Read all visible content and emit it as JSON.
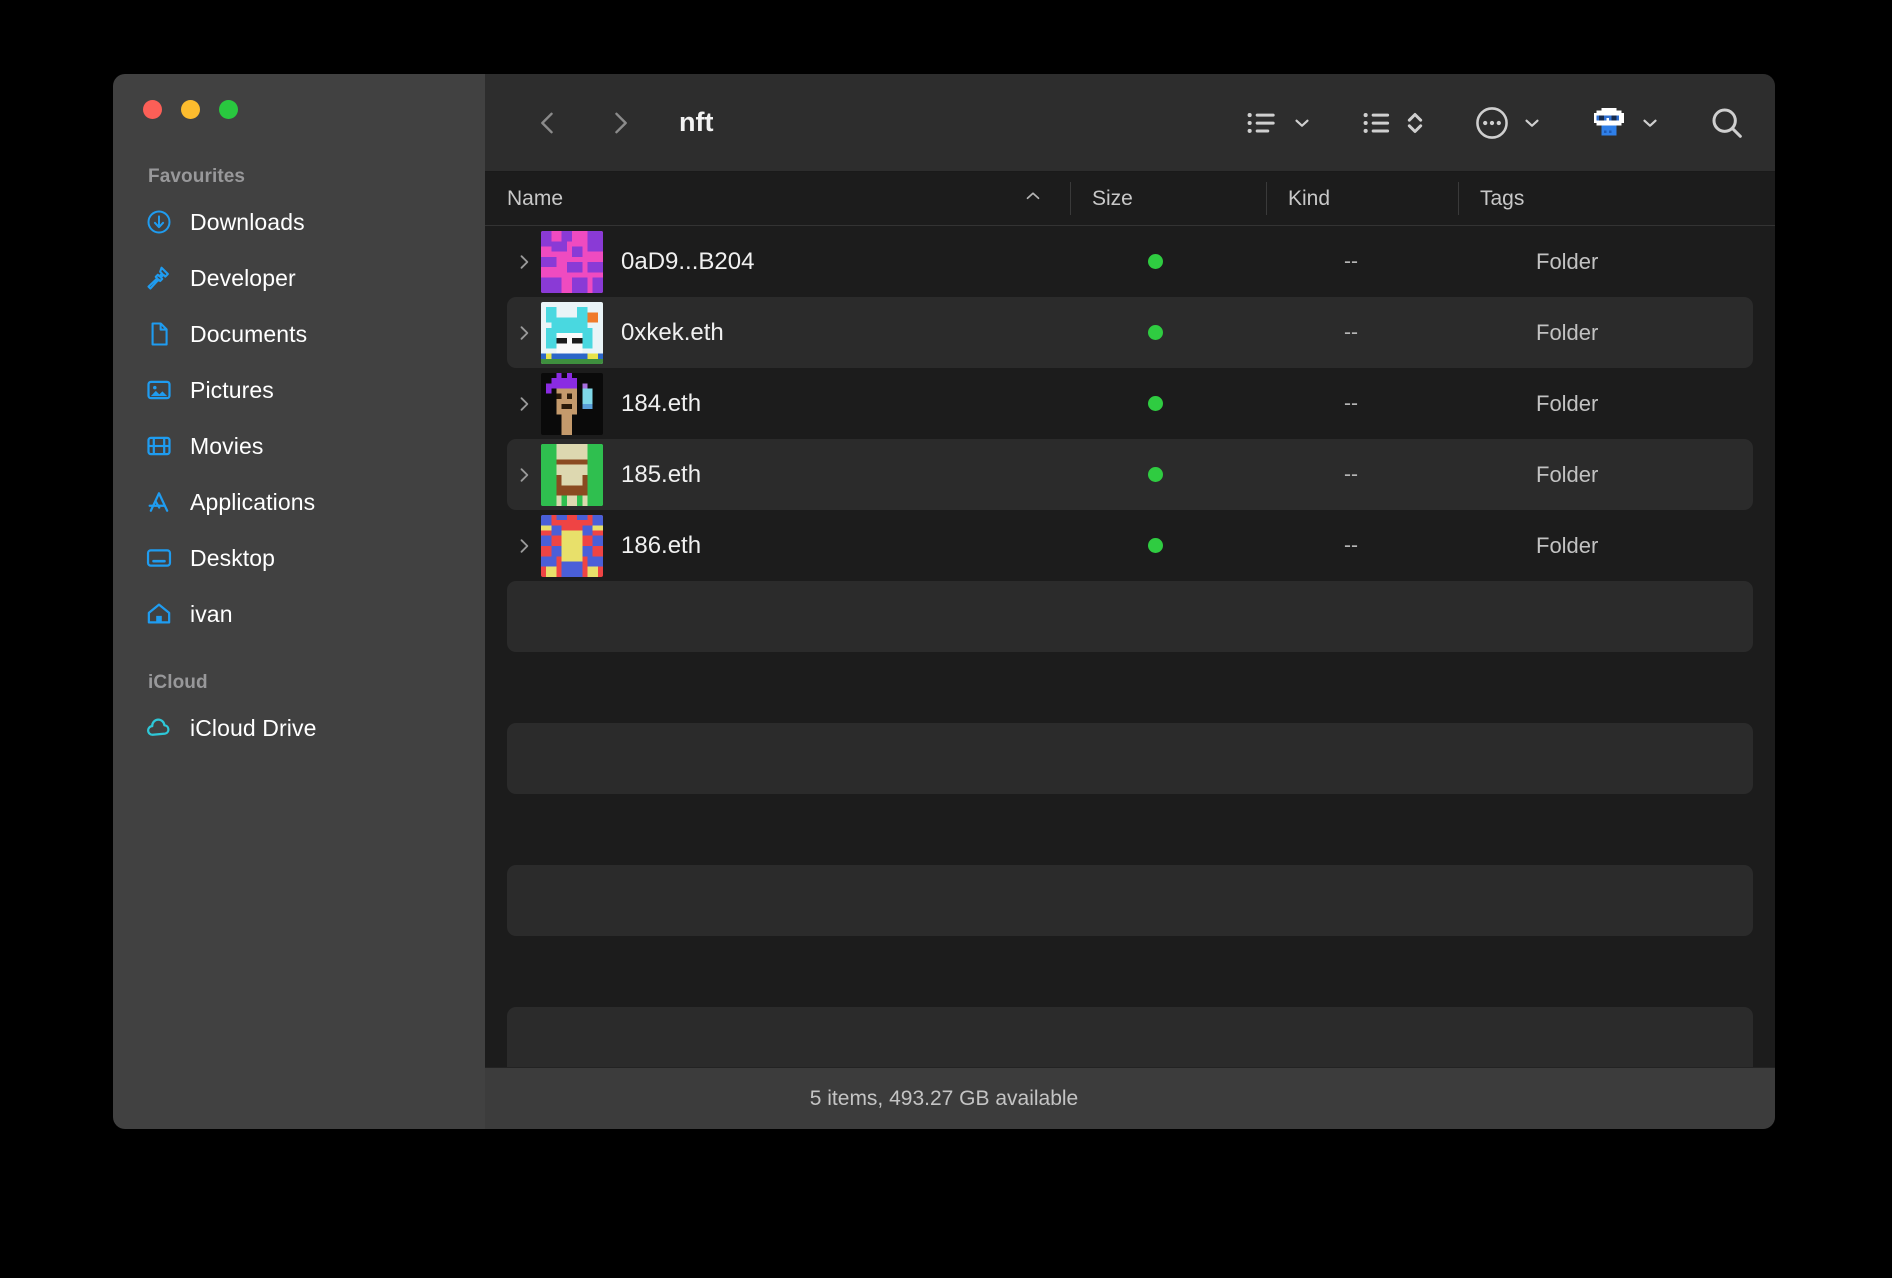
{
  "window": {
    "traffic_lights": [
      "close",
      "minimize",
      "zoom"
    ],
    "colors": {
      "desktop": "#000000",
      "sidebar": "#414141",
      "content": "#1c1c1c",
      "toolbar": "#2d2d2d",
      "status_bar": "#3c3c3c",
      "accent_blue": "#1f9cf0",
      "accent_cyan": "#2ec8d8",
      "tag_green": "#2fcc41",
      "row_alt": "#2b2b2b"
    }
  },
  "sidebar": {
    "sections": [
      {
        "title": "Favourites",
        "items": [
          {
            "label": "Downloads",
            "icon": "downloads-circle-arrow-icon"
          },
          {
            "label": "Developer",
            "icon": "hammer-icon"
          },
          {
            "label": "Documents",
            "icon": "document-page-icon"
          },
          {
            "label": "Pictures",
            "icon": "photo-icon"
          },
          {
            "label": "Movies",
            "icon": "film-strip-icon"
          },
          {
            "label": "Applications",
            "icon": "app-store-a-icon"
          },
          {
            "label": "Desktop",
            "icon": "desktop-monitor-icon"
          },
          {
            "label": "ivan",
            "icon": "home-house-icon"
          }
        ]
      },
      {
        "title": "iCloud",
        "items": [
          {
            "label": "iCloud Drive",
            "icon": "cloud-icon"
          }
        ]
      }
    ]
  },
  "toolbar": {
    "back_label": "Back",
    "forward_label": "Forward",
    "title": "nft",
    "buttons": [
      {
        "name": "view-options",
        "icon": "list-view-icon",
        "chevron": true
      },
      {
        "name": "group-sort",
        "icon": "list-sort-icon",
        "chevron": false
      },
      {
        "name": "more-actions",
        "icon": "ellipsis-circle-icon",
        "chevron": true
      },
      {
        "name": "share-avatar",
        "icon": "pixel-cloud-avatar-icon",
        "chevron": true
      },
      {
        "name": "search",
        "icon": "search-magnifier-icon",
        "chevron": false
      }
    ]
  },
  "columns": [
    {
      "key": "name",
      "label": "Name",
      "sorted": true,
      "sort_direction": "ascending"
    },
    {
      "key": "size",
      "label": "Size",
      "sorted": false,
      "sort_direction": ""
    },
    {
      "key": "kind",
      "label": "Kind",
      "sorted": false,
      "sort_direction": ""
    },
    {
      "key": "tags",
      "label": "Tags",
      "sorted": false,
      "sort_direction": ""
    }
  ],
  "files": [
    {
      "name": "0aD9...B204",
      "size": "--",
      "kind": "Folder",
      "tag_color": "#2fcc41",
      "expandable": true,
      "thumbnail": "pink-purple-pixel-art"
    },
    {
      "name": "0xkek.eth",
      "size": "--",
      "kind": "Folder",
      "tag_color": "#2fcc41",
      "expandable": true,
      "thumbnail": "cyan-cat-pixel-art"
    },
    {
      "name": "184.eth",
      "size": "--",
      "kind": "Folder",
      "tag_color": "#2fcc41",
      "expandable": true,
      "thumbnail": "purple-hair-punk-pixel-art"
    },
    {
      "name": "185.eth",
      "size": "--",
      "kind": "Folder",
      "tag_color": "#2fcc41",
      "expandable": true,
      "thumbnail": "green-zombie-pixel-art"
    },
    {
      "name": "186.eth",
      "size": "--",
      "kind": "Folder",
      "tag_color": "#2fcc41",
      "expandable": true,
      "thumbnail": "red-blue-mask-pixel-art"
    }
  ],
  "status": {
    "text": "5 items, 493.27 GB available",
    "item_count": 5,
    "available": "493.27 GB"
  }
}
